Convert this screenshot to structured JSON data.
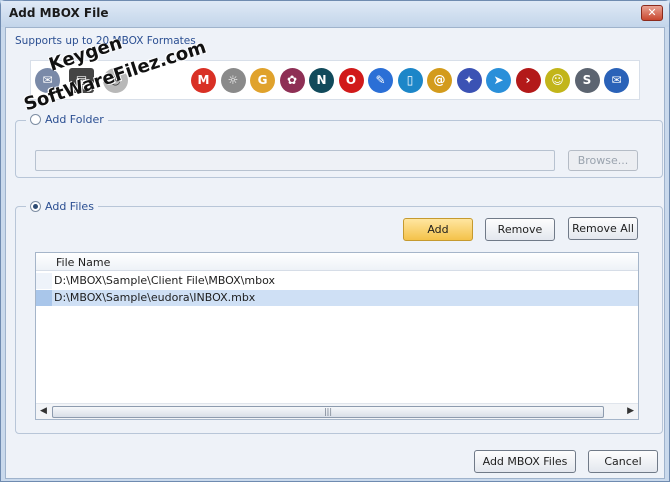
{
  "window": {
    "title": "Add MBOX File",
    "close_glyph": "✕"
  },
  "supports_text": "Supports up to 20 MBOX Formates",
  "client_icons": [
    {
      "name": "gmail",
      "glyph": "M",
      "color": "#d93025"
    },
    {
      "name": "gnu",
      "glyph": "☼",
      "color": "#8a8a8a"
    },
    {
      "name": "g-app",
      "glyph": "G",
      "color": "#e0a22c"
    },
    {
      "name": "grape",
      "glyph": "✿",
      "color": "#8e2f55"
    },
    {
      "name": "netscape",
      "glyph": "N",
      "color": "#114a5b"
    },
    {
      "name": "opera",
      "glyph": "O",
      "color": "#d11a1a"
    },
    {
      "name": "postbox",
      "glyph": "✎",
      "color": "#2b6fd6"
    },
    {
      "name": "book",
      "glyph": "▯",
      "color": "#1c86c8"
    },
    {
      "name": "at",
      "glyph": "@",
      "color": "#d39b1c"
    },
    {
      "name": "compass",
      "glyph": "✦",
      "color": "#3b52b4"
    },
    {
      "name": "cursor",
      "glyph": "➤",
      "color": "#2a8fd9"
    },
    {
      "name": "arrow-red",
      "glyph": "›",
      "color": "#b31919"
    },
    {
      "name": "yellow-face",
      "glyph": "☺",
      "color": "#c2b51a"
    },
    {
      "name": "seamonkey",
      "glyph": "S",
      "color": "#5c6470"
    },
    {
      "name": "thunderbird",
      "glyph": "✉",
      "color": "#2a62b8"
    }
  ],
  "add_folder": {
    "label": "Add Folder",
    "path_value": "",
    "browse_label": "Browse..."
  },
  "add_files": {
    "label": "Add Files",
    "add_label": "Add",
    "remove_label": "Remove",
    "remove_all_label": "Remove All",
    "column_header": "File Name",
    "files": [
      "D:\\MBOX\\Sample\\Client File\\MBOX\\mbox",
      "D:\\MBOX\\Sample\\eudora\\INBOX.mbx"
    ],
    "selected_index": 1
  },
  "footer": {
    "add_mbox_label": "Add MBOX Files",
    "cancel_label": "Cancel"
  },
  "watermark": {
    "line1": "Keygen",
    "line2": "SoftWareFilez.com"
  },
  "colors": {
    "accent": "#f4c24a",
    "selection": "#cfe0f5",
    "title_text": "#2b4f92"
  }
}
